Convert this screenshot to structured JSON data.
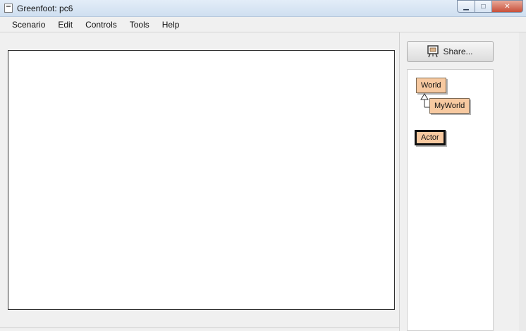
{
  "window": {
    "title": "Greenfoot: pc6",
    "minimize_glyph": "▁",
    "maximize_glyph": "□",
    "close_glyph": "✕"
  },
  "menu": {
    "items": [
      "Scenario",
      "Edit",
      "Controls",
      "Tools",
      "Help"
    ]
  },
  "share_button": {
    "label": "Share...",
    "icon": "share-easel-icon"
  },
  "class_diagram": {
    "classes": [
      {
        "name": "World",
        "selected": false
      },
      {
        "name": "MyWorld",
        "selected": false
      },
      {
        "name": "Actor",
        "selected": true
      }
    ]
  },
  "colors": {
    "class_fill": "#f7c9a0",
    "class_border": "#7f6b55",
    "world_border": "#303030"
  }
}
